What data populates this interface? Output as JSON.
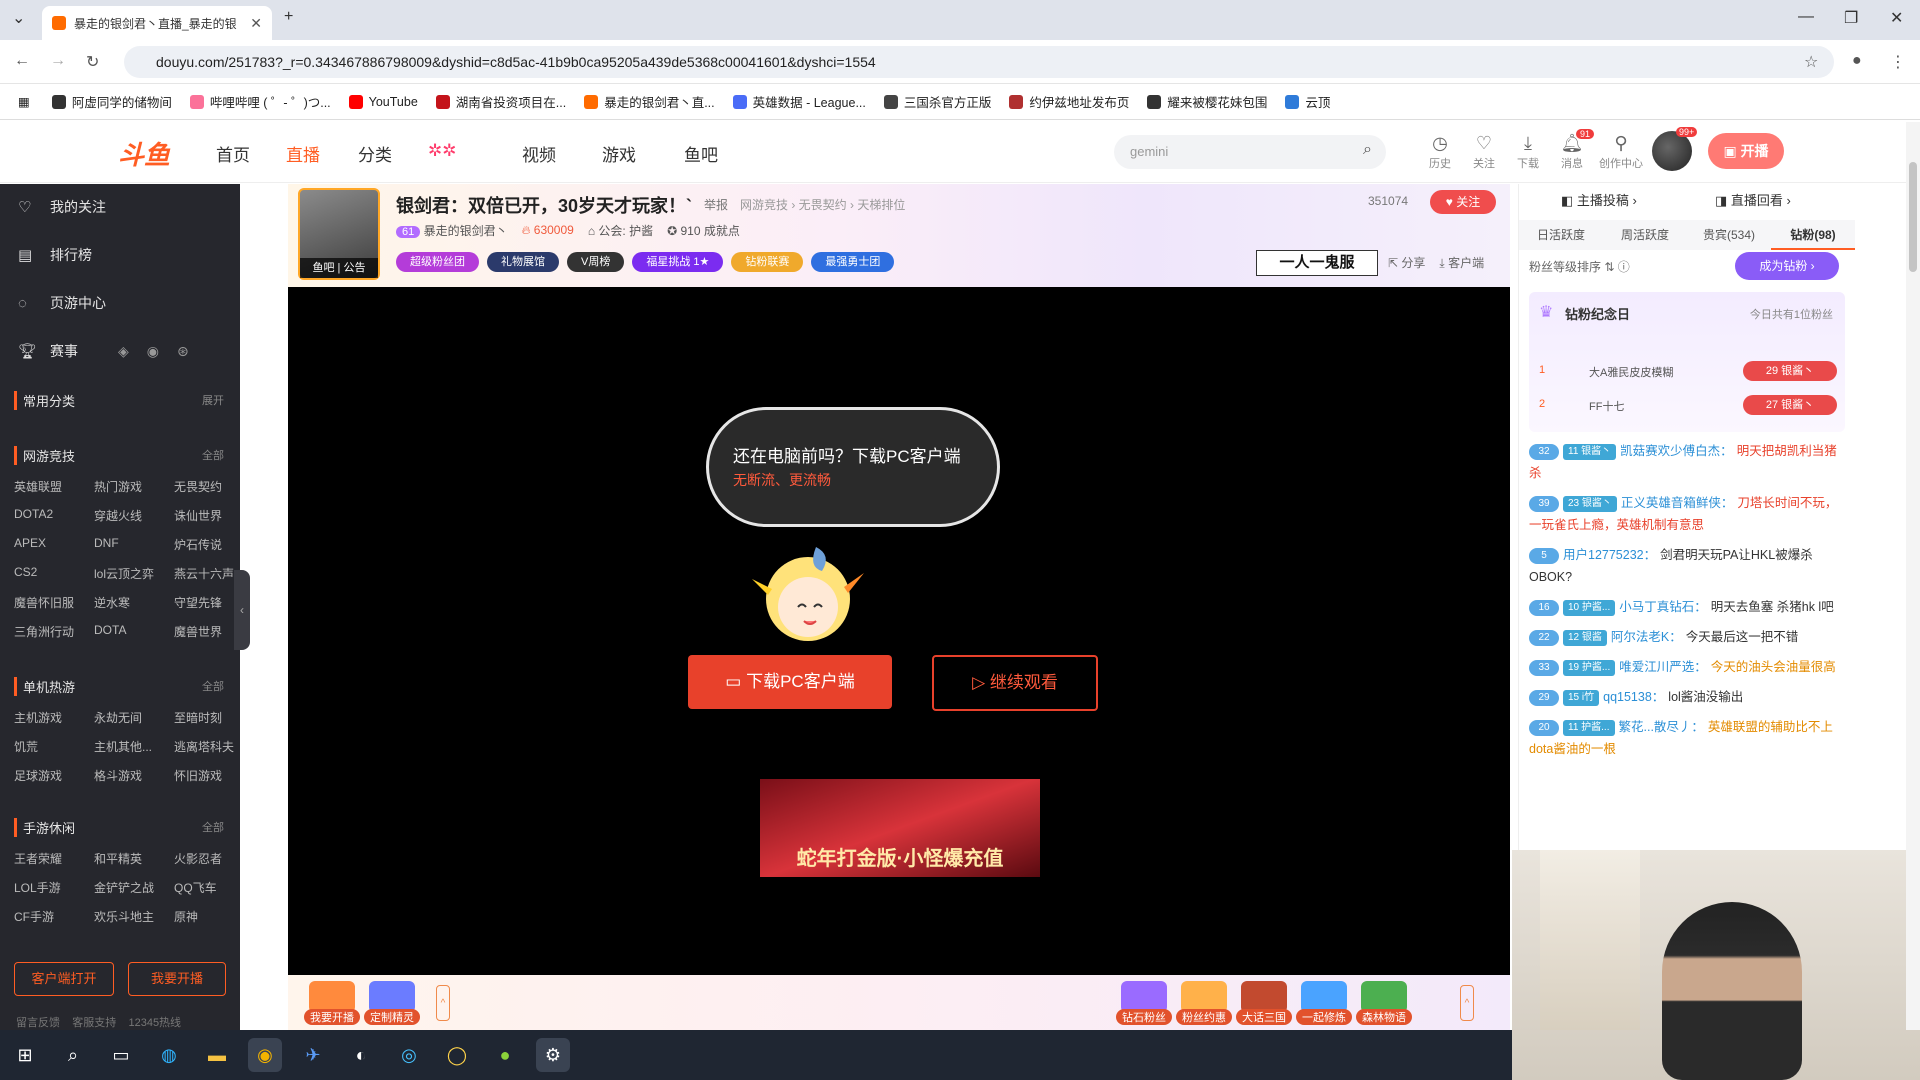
{
  "browser": {
    "tab_title": "暴走的银剑君丶直播_暴走的银",
    "url": "douyu.com/251783?_r=0.343467886798009&dyshid=c8d5ac-41b9b0ca95205a439de5368c00041601&dyshci=1554",
    "bookmarks": [
      {
        "label": "阿虚同学的储物间",
        "color": "#333333"
      },
      {
        "label": "哔哩哔哩 ( ゜- ゜)つ...",
        "color": "#fb7299"
      },
      {
        "label": "YouTube",
        "color": "#ff0000"
      },
      {
        "label": "湖南省投资项目在...",
        "color": "#c4141b"
      },
      {
        "label": "暴走的银剑君丶直...",
        "color": "#ff6b00"
      },
      {
        "label": "英雄数据 - League...",
        "color": "#4a6cf7"
      },
      {
        "label": "三国杀官方正版",
        "color": "#444444"
      },
      {
        "label": "约伊兹地址发布页",
        "color": "#b03030"
      },
      {
        "label": "耀来被樱花妹包围",
        "color": "#333333"
      },
      {
        "label": "云顶",
        "color": "#2f7bd9"
      }
    ]
  },
  "header": {
    "nav": [
      "首页",
      "直播",
      "分类",
      "视频",
      "游戏",
      "鱼吧"
    ],
    "search_placeholder": "gemini",
    "icons": [
      {
        "label": "历史",
        "badge": ""
      },
      {
        "label": "关注",
        "badge": ""
      },
      {
        "label": "下载",
        "badge": ""
      },
      {
        "label": "消息",
        "badge": "91"
      },
      {
        "label": "创作中心",
        "badge": ""
      }
    ],
    "avatar_badge": "99+",
    "open_label": "开播"
  },
  "sidebar": {
    "main": [
      "我的关注",
      "排行榜",
      "页游中心",
      "赛事"
    ],
    "common": {
      "title": "常用分类",
      "more": "展开"
    },
    "sections": [
      {
        "title": "网游竞技",
        "more": "全部",
        "items": [
          "英雄联盟",
          "热门游戏",
          "无畏契约",
          "DOTA2",
          "穿越火线",
          "诛仙世界",
          "APEX",
          "DNF",
          "炉石传说",
          "CS2",
          "lol云顶之弈",
          "燕云十六声",
          "魔兽怀旧服",
          "逆水寒",
          "守望先锋",
          "三角洲行动",
          "DOTA",
          "魔兽世界"
        ]
      },
      {
        "title": "单机热游",
        "more": "全部",
        "items": [
          "主机游戏",
          "永劫无间",
          "至暗时刻",
          "饥荒",
          "主机其他...",
          "逃离塔科夫",
          "足球游戏",
          "格斗游戏",
          "怀旧游戏"
        ]
      },
      {
        "title": "手游休闲",
        "more": "全部",
        "items": [
          "王者荣耀",
          "和平精英",
          "火影忍者",
          "LOL手游",
          "金铲铲之战",
          "QQ飞车",
          "CF手游",
          "欢乐斗地主",
          "原神"
        ]
      }
    ],
    "btn_client": "客户端打开",
    "btn_live": "我要开播",
    "footer": [
      "留言反馈",
      "客服支持",
      "12345热线"
    ]
  },
  "room": {
    "avatar_caption": "鱼吧 | 公告",
    "title": "银剑君：双倍已开，30岁天才玩家！`",
    "report": "举报",
    "crumbs": "网游竞技 › 无畏契约 › 天梯排位",
    "level": "61",
    "name": "暴走的银剑君丶",
    "fans": "630009",
    "guild": "公会: 护酱",
    "achievements": "910 成就点",
    "pills": [
      {
        "label": "超级粉丝团",
        "color": "#b43cd9"
      },
      {
        "label": "礼物展馆",
        "color": "#2b3a6b"
      },
      {
        "label": "V周榜",
        "color": "#333333"
      },
      {
        "label": "福星挑战 1★",
        "color": "#7b2cf0"
      },
      {
        "label": "钻粉联赛",
        "color": "#f0a92c"
      },
      {
        "label": "最强勇士团",
        "color": "#2f6fe0"
      }
    ],
    "hot": "351074",
    "follow": "关注",
    "rank_badge": "一人一鬼服",
    "share": "分享",
    "client": "客户端"
  },
  "player": {
    "bubble_line1": "还在电脑前吗？下载PC客户端",
    "bubble_line2": "无断流、更流畅",
    "download_btn": "下载PC客户端",
    "continue_btn": "继续观看",
    "ad_text": "蛇年打金版·小怪爆充值"
  },
  "giftbar": {
    "left": [
      {
        "label": "我要开播",
        "color": "#ff8a3d"
      },
      {
        "label": "定制精灵",
        "color": "#6b7cff"
      }
    ],
    "right": [
      {
        "label": "钻石粉丝",
        "color": "#9a6bff"
      },
      {
        "label": "粉丝约惠",
        "color": "#ffb14a"
      },
      {
        "label": "大话三国",
        "color": "#c24a2f"
      },
      {
        "label": "一起修炼",
        "color": "#4aa3ff"
      },
      {
        "label": "森林物语",
        "color": "#4caf50"
      }
    ]
  },
  "rpanel": {
    "submit": "主播投稿",
    "replay": "直播回看",
    "tabs": [
      "日活跃度",
      "周活跃度",
      "贵宾(534)",
      "钻粉(98)"
    ],
    "fan_sort": "粉丝等级排序",
    "join": "成为钻粉",
    "fan_day": "钻粉纪念日",
    "fan_today": "今日共有1位粉丝",
    "fans": [
      {
        "rank": "1",
        "name": "大A雅民皮皮模糊",
        "badge": "29 银酱丶"
      },
      {
        "rank": "2",
        "name": "FF十七",
        "badge": "27 银酱丶"
      }
    ],
    "chat": [
      {
        "lv": "32",
        "badge": "11 银酱丶",
        "user": "凯菇赛欢少傅白杰：",
        "text": "明天把胡凯利当猪杀",
        "style": "red"
      },
      {
        "lv": "39",
        "badge": "23 银酱丶",
        "user": "正义英雄音箱鲜侠：",
        "text": "刀塔长时间不玩，一玩雀氏上瘾，英雄机制有意思",
        "style": "red"
      },
      {
        "lv": "5",
        "badge": "",
        "user": "用户12775232：",
        "text": "剑君明天玩PA让HKL被爆杀OBOK?",
        "style": ""
      },
      {
        "lv": "16",
        "badge": "10 护酱...",
        "user": "小马丁真钻石：",
        "text": "明天去鱼塞 杀猪hk l吧",
        "style": ""
      },
      {
        "lv": "22",
        "badge": "12 银酱",
        "user": "阿尔法老K：",
        "text": "今天最后这一把不错",
        "style": ""
      },
      {
        "lv": "33",
        "badge": "19 护酱...",
        "user": "唯爱江川严选：",
        "text": "今天的油头会油量很高",
        "style": "gold"
      },
      {
        "lv": "29",
        "badge": "15 i竹",
        "user": "qq15138：",
        "text": "lol酱油没输出",
        "style": ""
      },
      {
        "lv": "20",
        "badge": "11 护酱...",
        "user": "繁花...散尽丿：",
        "text": "英雄联盟的辅助比不上dota酱油的一根",
        "style": "gold"
      }
    ]
  }
}
